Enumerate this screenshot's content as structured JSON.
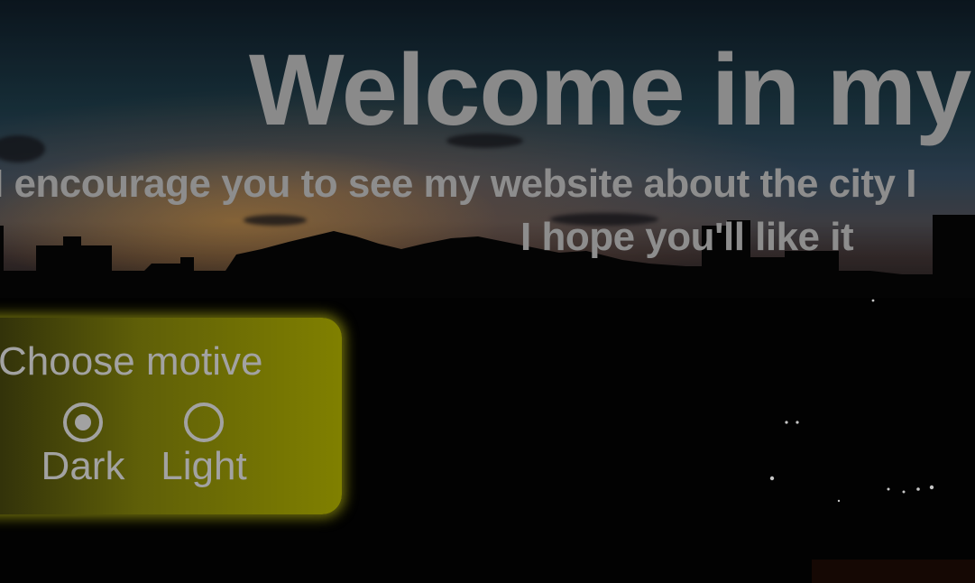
{
  "header": {
    "title": "Welcome in my C",
    "subtitle_line1": "I encourage you to see my website about the city I",
    "subtitle_line2": "I hope you'll like it"
  },
  "theme_selector": {
    "title": "Choose motive",
    "options": [
      {
        "label": "Dark",
        "checked": true
      },
      {
        "label": "Light",
        "checked": false
      }
    ],
    "accent_color": "#808000"
  },
  "background": {
    "scene": "city-skyline-at-dusk"
  }
}
